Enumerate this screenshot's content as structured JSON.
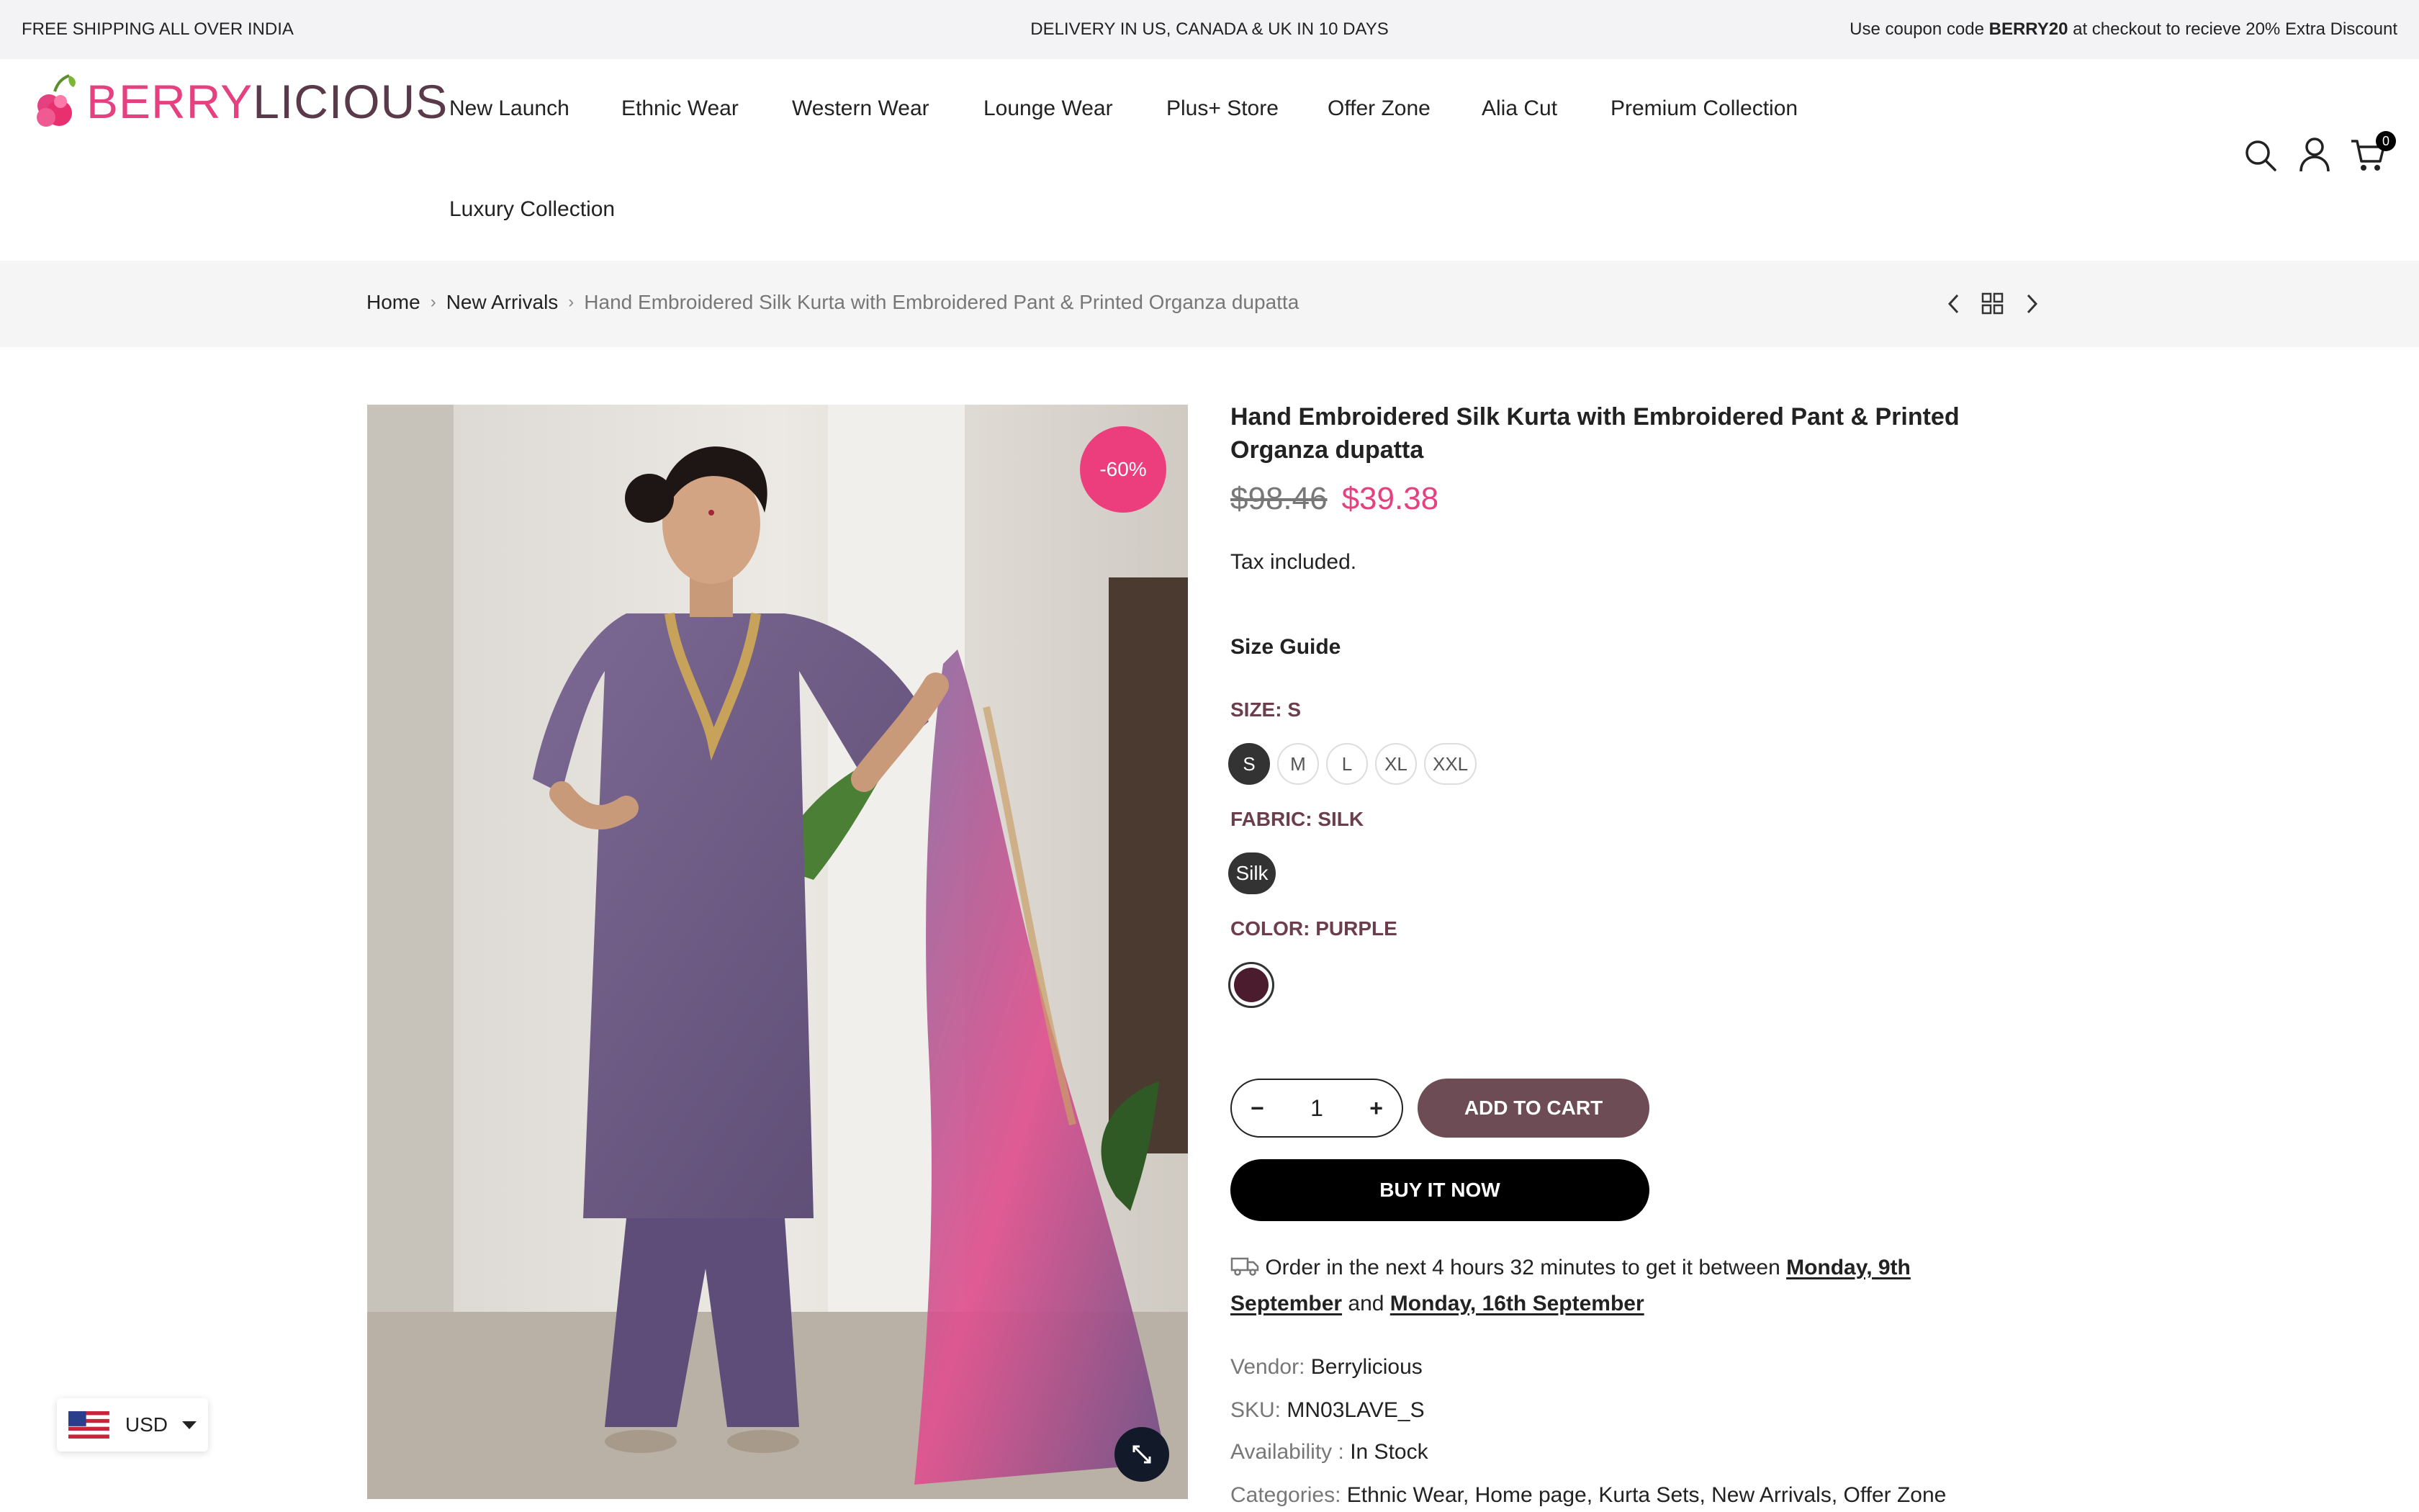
{
  "announcement": {
    "left": "FREE SHIPPING ALL OVER INDIA",
    "center": "DELIVERY IN US, CANADA & UK IN 10 DAYS",
    "right_prefix": "Use coupon code ",
    "right_code": "BERRY20",
    "right_suffix": " at checkout to recieve 20% Extra Discount"
  },
  "header": {
    "logo_part1": "BERRY",
    "logo_part2": "LICIOUS",
    "nav": [
      "New Launch",
      "Ethnic Wear",
      "Western Wear",
      "Lounge Wear",
      "Plus+ Store",
      "Offer Zone",
      "Alia Cut",
      "Premium Collection",
      "Luxury Collection"
    ],
    "cart_count": "0",
    "icons": [
      "search-icon",
      "account-icon",
      "cart-icon"
    ]
  },
  "breadcrumb": {
    "items": [
      "Home",
      "New Arrivals"
    ],
    "current": "Hand Embroidered Silk Kurta with Embroidered Pant & Printed Organza dupatta",
    "icons": [
      "chevron-left-icon",
      "grid-icon",
      "chevron-right-icon"
    ]
  },
  "product": {
    "discount_badge": "-60%",
    "title": "Hand Embroidered Silk Kurta with Embroidered Pant & Printed Organza dupatta",
    "old_price": "$98.46",
    "new_price": "$39.38",
    "tax_note": "Tax included.",
    "size_guide": "Size Guide",
    "size_label": "SIZE: S",
    "sizes": [
      "S",
      "M",
      "L",
      "XL",
      "XXL"
    ],
    "selected_size": "S",
    "fabric_label": "FABRIC: SILK",
    "fabric_option": "Silk",
    "color_label": "COLOR: PURPLE",
    "color_swatch": "#4a1c2e",
    "quantity": "1",
    "add_to_cart": "ADD TO CART",
    "buy_now": "BUY IT NOW",
    "delivery_prefix": "Order in the next 4 hours 32 minutes to get it between ",
    "delivery_date1": "Monday, 9th September",
    "delivery_and": " and ",
    "delivery_date2": "Monday, 16th September",
    "vendor_label": "Vendor:",
    "vendor": "Berrylicious",
    "sku_label": "SKU:",
    "sku": "MN03LAVE_S",
    "availability_label": "Availability :",
    "availability": "In Stock",
    "categories_label": "Categories:",
    "categories": "Ethnic Wear, Home page, Kurta Sets, New Arrivals, Offer Zone"
  },
  "currency": {
    "code": "USD"
  },
  "colors": {
    "brand_pink": "#e5407f",
    "add_to_cart_bg": "#6e4c55",
    "option_label": "#6b3e4e"
  }
}
